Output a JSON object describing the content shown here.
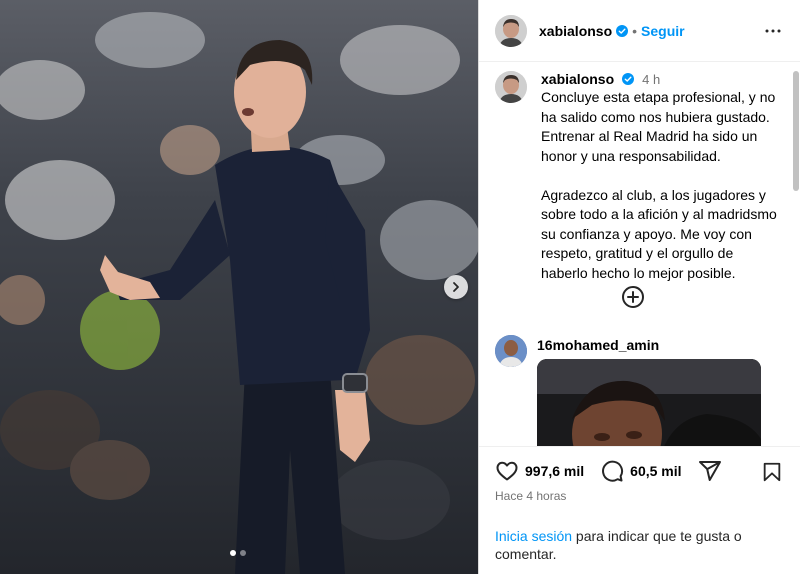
{
  "post": {
    "username": "xabialonso",
    "follow_label": "Seguir",
    "separator": "•"
  },
  "caption": {
    "username": "xabialonso",
    "time": "4 h",
    "text": "Concluye esta etapa profesional, y no ha salido como nos hubiera gustado. Entrenar al Real Madrid ha sido un honor y una responsabilidad.\n\nAgradezco al club, a los jugadores y sobre todo a la afición y al madridsmo su confianza y apoyo. Me voy con respeto, gratitud y el orgullo de haberlo hecho lo mejor posible."
  },
  "comment": {
    "username": "16mohamed_amin"
  },
  "actions": {
    "likes": "997,6 mil",
    "comments": "60,5 mil"
  },
  "post_time": "Hace 4 horas",
  "login": {
    "link_label": "Inicia sesión",
    "rest_text": " para indicar que te gusta o comentar."
  },
  "colors": {
    "accent": "#0095f6",
    "muted": "#737373",
    "border": "#dbdbdb"
  },
  "icons": [
    "chevron-right-icon",
    "verified-badge-icon",
    "more-options-icon",
    "add-circle-icon",
    "heart-icon",
    "comment-icon",
    "share-icon",
    "bookmark-icon"
  ]
}
